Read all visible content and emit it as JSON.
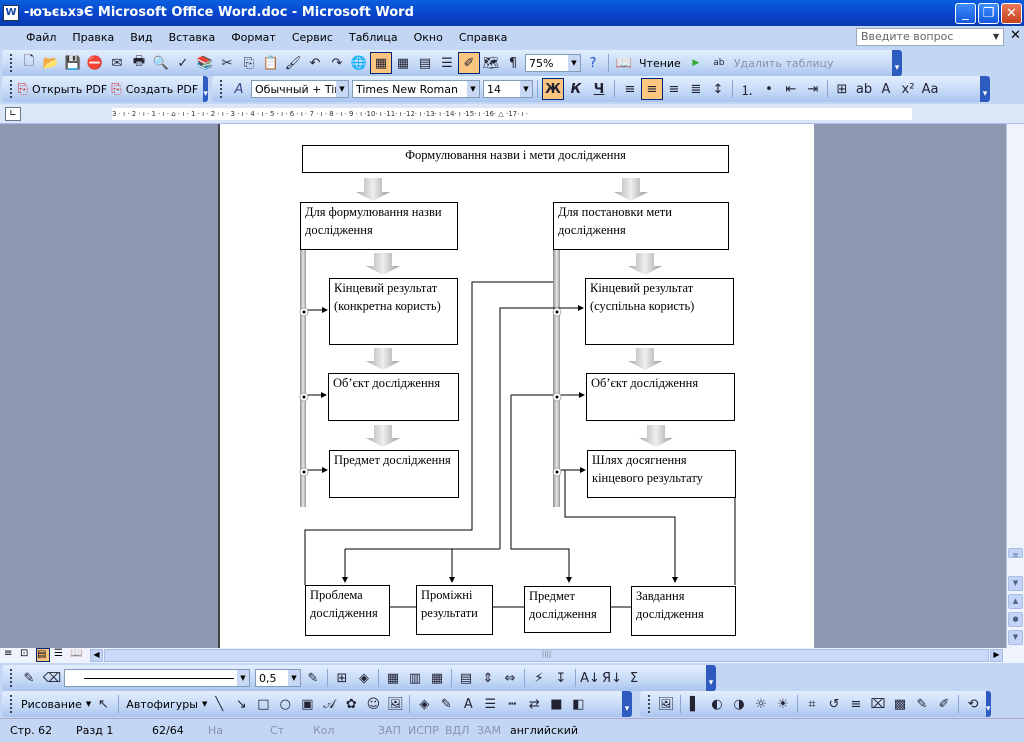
{
  "window": {
    "title": "-юъєьхэЄ Microsoft Office Word.doc - Microsoft Word",
    "app_icon": "word-icon"
  },
  "menu": [
    "Файл",
    "Правка",
    "Вид",
    "Вставка",
    "Формат",
    "Сервис",
    "Таблица",
    "Окно",
    "Справка"
  ],
  "help": {
    "placeholder": "Введите вопрос"
  },
  "standard_toolbar": {
    "icons_a": [
      "new-document-icon",
      "open-icon",
      "save-icon",
      "permission-icon",
      "print-preview-mail-icon",
      "print-icon",
      "print-preview-icon",
      "spelling-icon",
      "research-icon",
      "cut-icon",
      "copy-icon",
      "paste-icon",
      "format-painter-icon",
      "undo-icon",
      "redo-icon",
      "hyperlink-icon",
      "tables-borders-icon",
      "insert-table-icon",
      "insert-excel-icon",
      "columns-icon",
      "drawing-icon",
      "document-map-icon",
      "show-formatting-icon"
    ],
    "zoom": "75%",
    "read_label": "Чтение",
    "delete_table_label": "Удалить таблицу"
  },
  "pdf_toolbar": {
    "open_pdf": "Открыть PDF",
    "create_pdf": "Создать PDF"
  },
  "formatting_toolbar": {
    "style": "Обычный + Times",
    "font": "Times New Roman",
    "size": "14",
    "bold": "Ж",
    "italic": "К",
    "underline": "Ч",
    "active": [
      "bold",
      "align-center"
    ]
  },
  "ruler": {
    "ticks": "3 · ı · 2 · ı · 1 · ı · ⌂ · ı · 1 · ı · 2 · ı · 3 · ı · 4 · ı · 5 · ı · 6 · ı · 7 · ı · 8 · ı · 9 · ı ·10· ı ·11· ı ·12· ı ·13· ı ·14· ı ·15· ı ·16· △ ·17· ı ·"
  },
  "diagram": {
    "title": "Формулювання назви і мети дослідження",
    "left_head": "Для формулювання назви дослідження",
    "right_head": "Для постановки мети дослідження",
    "left": [
      "Кінцевий результат (конкретна користь)",
      "Об’єкт дослідження",
      "Предмет дослідження"
    ],
    "right": [
      "Кінцевий результат (суспільна користь)",
      "Об’єкт дослідження",
      "Шлях досягнення кінцевого результату"
    ],
    "bottom": [
      "Проблема дослідження",
      "Проміжні результати",
      "Предмет дослідження",
      "Завдання дослідження"
    ]
  },
  "tables_toolbar": {
    "line_weight": "0,5"
  },
  "drawing_toolbar": {
    "drawing": "Рисование",
    "autoshapes": "Автофигуры"
  },
  "status": {
    "page": "Стр. 62",
    "section": "Разд 1",
    "pages": "62/64",
    "at": "На",
    "line": "Ст",
    "col": "Кол",
    "rec": "ЗАП",
    "trk": "ИСПР",
    "ext": "ВДЛ",
    "ovr": "ЗАМ",
    "language": "английский"
  }
}
